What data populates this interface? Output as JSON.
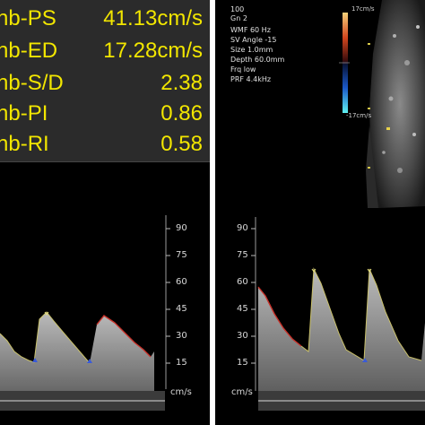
{
  "left_panel": {
    "measurements": [
      {
        "label": "nb-PS",
        "value": "41.13cm/s"
      },
      {
        "label": "nb-ED",
        "value": "17.28cm/s"
      },
      {
        "label": "nb-S/D",
        "value": "2.38"
      },
      {
        "label": "nb-PI",
        "value": "0.86"
      },
      {
        "label": "nb-RI",
        "value": "0.58"
      }
    ],
    "scale_ticks": [
      "90",
      "75",
      "60",
      "45",
      "30",
      "15"
    ],
    "scale_unit": "cm/s"
  },
  "right_panel": {
    "settings": [
      "100",
      "Gn  2",
      "WMF 60 Hz",
      "SV Angle -15",
      "Size  1.0mm",
      "Depth 60.0mm",
      "Frq low",
      "PRF  4.4kHz"
    ],
    "colorbar_top": "17cm/s",
    "colorbar_bottom": "-17cm/s",
    "scale_ticks": [
      "90",
      "75",
      "60",
      "45",
      "30",
      "15"
    ],
    "scale_unit": "cm/s"
  },
  "colors": {
    "measurement_text": "#f2e600",
    "panel_background": "#000000",
    "measurement_box": "#2b2b2b",
    "divider": "#ffffff"
  }
}
